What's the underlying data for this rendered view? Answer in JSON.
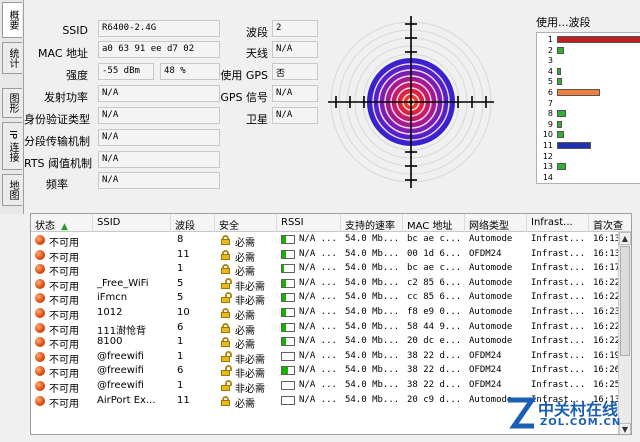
{
  "tabs": [
    "概要",
    "统计",
    "图形",
    "IP 连接",
    "地图"
  ],
  "info_left": [
    {
      "label": "SSID",
      "value": "R6400-2.4G"
    },
    {
      "label": "MAC 地址",
      "value": "a0 63 91 ee d7 02"
    },
    {
      "label": "强度",
      "value": "-55 dBm",
      "value2": "48 %"
    },
    {
      "label": "发射功率",
      "value": "N/A"
    },
    {
      "label": "身份验证类型",
      "value": "N/A"
    },
    {
      "label": "分段传输机制",
      "value": "N/A"
    },
    {
      "label": "RTS 阈值机制",
      "value": "N/A"
    },
    {
      "label": "频率",
      "value": "N/A"
    }
  ],
  "info_right": [
    {
      "label": "波段",
      "value": "2"
    },
    {
      "label": "天线",
      "value": "N/A"
    },
    {
      "label": "使用 GPS",
      "value": "否"
    },
    {
      "label": "GPS 信号",
      "value": "N/A"
    },
    {
      "label": "卫星",
      "value": "N/A"
    }
  ],
  "channel_chart": {
    "title": "使用...波段",
    "channels": [
      "1",
      "2",
      "3",
      "4",
      "5",
      "6",
      "7",
      "8",
      "9",
      "10",
      "11",
      "12",
      "13",
      "14"
    ],
    "usage": [
      {
        "channel": 1,
        "level": 1.0,
        "color": "#c02020"
      },
      {
        "channel": 2,
        "level": 0.08,
        "color": "#30b030"
      },
      {
        "channel": 4,
        "level": 0.04,
        "color": "#30b030"
      },
      {
        "channel": 5,
        "level": 0.06,
        "color": "#30b030"
      },
      {
        "channel": 6,
        "level": 0.5,
        "color": "#f08040"
      },
      {
        "channel": 8,
        "level": 0.1,
        "color": "#30b030"
      },
      {
        "channel": 9,
        "level": 0.06,
        "color": "#30b030"
      },
      {
        "channel": 10,
        "level": 0.08,
        "color": "#30b030"
      },
      {
        "channel": 11,
        "level": 0.4,
        "color": "#2030b0"
      },
      {
        "channel": 13,
        "level": 0.1,
        "color": "#30b030"
      }
    ]
  },
  "table": {
    "columns": [
      "状态",
      "SSID",
      "波段",
      "安全",
      "RSSI",
      "支持的速率",
      "MAC 地址",
      "网络类型",
      "Infrast...",
      "首次查"
    ],
    "rows": [
      {
        "status": "不可用",
        "ssid": "",
        "channel": "8",
        "locked": true,
        "security": "必需",
        "rssi_fill": 0.3,
        "rssi": "N/A ...",
        "rate": "54.0 Mb...",
        "mac": "bc ae c...",
        "type": "Automode",
        "infra": "Infrast...",
        "first": "16:13"
      },
      {
        "status": "不可用",
        "ssid": "",
        "channel": "11",
        "locked": true,
        "security": "必需",
        "rssi_fill": 0.3,
        "rssi": "N/A ...",
        "rate": "54.0 Mb...",
        "mac": "00 1d 6...",
        "type": "OFDM24",
        "infra": "Infrast...",
        "first": "16:13"
      },
      {
        "status": "不可用",
        "ssid": "",
        "channel": "1",
        "locked": true,
        "security": "必需",
        "rssi_fill": 0.2,
        "rssi": "N/A ...",
        "rate": "54.0 Mb...",
        "mac": "bc ae c...",
        "type": "Automode",
        "infra": "Infrast...",
        "first": "16:17"
      },
      {
        "status": "不可用",
        "ssid": "_Free_WiFi",
        "channel": "5",
        "locked": false,
        "security": "非必需",
        "rssi_fill": 0.3,
        "rssi": "N/A ...",
        "rate": "54.0 Mb...",
        "mac": "c2 85 6...",
        "type": "Automode",
        "infra": "Infrast...",
        "first": "16:22"
      },
      {
        "status": "不可用",
        "ssid": "iFmcn",
        "channel": "5",
        "locked": false,
        "security": "非必需",
        "rssi_fill": 0.3,
        "rssi": "N/A ...",
        "rate": "54.0 Mb...",
        "mac": "cc 85 6...",
        "type": "Automode",
        "infra": "Infrast...",
        "first": "16:22"
      },
      {
        "status": "不可用",
        "ssid": "1012",
        "channel": "10",
        "locked": true,
        "security": "必需",
        "rssi_fill": 0.3,
        "rssi": "N/A ...",
        "rate": "54.0 Mb...",
        "mac": "f8 e9 0...",
        "type": "Automode",
        "infra": "Infrast...",
        "first": "16:23"
      },
      {
        "status": "不可用",
        "ssid": "111澍怆背",
        "channel": "6",
        "locked": true,
        "security": "必需",
        "rssi_fill": 0.3,
        "rssi": "N/A ...",
        "rate": "54.0 Mb...",
        "mac": "58 44 9...",
        "type": "Automode",
        "infra": "Infrast...",
        "first": "16:22"
      },
      {
        "status": "不可用",
        "ssid": "8100",
        "channel": "1",
        "locked": true,
        "security": "必需",
        "rssi_fill": 0.3,
        "rssi": "N/A ...",
        "rate": "54.0 Mb...",
        "mac": "20 dc e...",
        "type": "Automode",
        "infra": "Infrast...",
        "first": "16:22"
      },
      {
        "status": "不可用",
        "ssid": "@freewifi",
        "channel": "1",
        "locked": false,
        "security": "非必需",
        "rssi_fill": 0.0,
        "rssi": "N/A ...",
        "rate": "54.0 Mb...",
        "mac": "38 22 d...",
        "type": "OFDM24",
        "infra": "Infrast...",
        "first": "16:19"
      },
      {
        "status": "不可用",
        "ssid": "@freewifi",
        "channel": "6",
        "locked": false,
        "security": "非必需",
        "rssi_fill": 0.5,
        "rssi": "N/A ...",
        "rate": "54.0 Mb...",
        "mac": "38 22 d...",
        "type": "OFDM24",
        "infra": "Infrast...",
        "first": "16:26"
      },
      {
        "status": "不可用",
        "ssid": "@freewifi",
        "channel": "1",
        "locked": false,
        "security": "非必需",
        "rssi_fill": 0.0,
        "rssi": "N/A ...",
        "rate": "54.0 Mb...",
        "mac": "38 22 d...",
        "type": "OFDM24",
        "infra": "Infrast...",
        "first": "16:25"
      },
      {
        "status": "不可用",
        "ssid": "AirPort Ex...",
        "channel": "11",
        "locked": true,
        "security": "必需",
        "rssi_fill": 0.0,
        "rssi": "N/A ...",
        "rate": "54.0 Mb...",
        "mac": "20 c9 d...",
        "type": "Automode",
        "infra": "Infrast...",
        "first": "16:13"
      }
    ]
  },
  "watermark": {
    "title": "中关村在线",
    "url": "ZOL.COM.CN"
  }
}
